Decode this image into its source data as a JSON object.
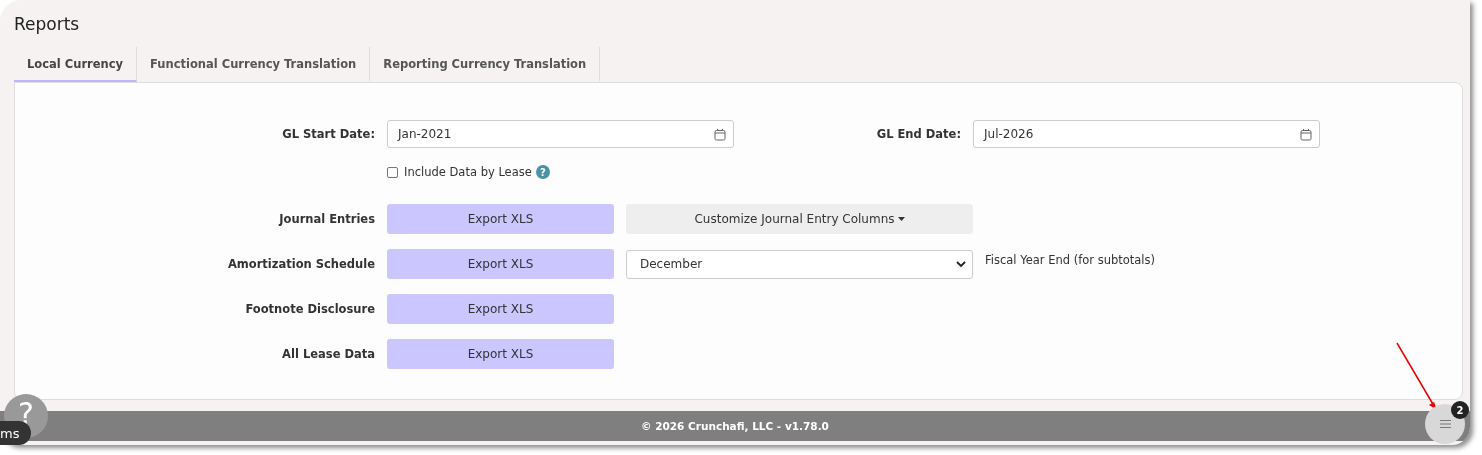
{
  "title": "Reports",
  "tabs": [
    {
      "label": "Local Currency",
      "selected": true
    },
    {
      "label": "Functional Currency Translation",
      "selected": false
    },
    {
      "label": "Reporting Currency Translation",
      "selected": false
    }
  ],
  "start_date": {
    "label": "GL Start Date:",
    "value": "Jan-2021"
  },
  "end_date": {
    "label": "GL End Date:",
    "value": "Jul-2026"
  },
  "include_by_lease": {
    "label": "Include Data by Lease",
    "checked": false,
    "help": "?"
  },
  "reports": [
    {
      "label": "Journal Entries",
      "button": "Export XLS",
      "extra": {
        "kind": "menu",
        "label": "Customize Journal Entry Columns"
      }
    },
    {
      "label": "Amortization Schedule",
      "button": "Export XLS",
      "extra": {
        "kind": "select",
        "value": "December",
        "note": "Fiscal Year End (for subtotals)"
      }
    },
    {
      "label": "Footnote Disclosure",
      "button": "Export XLS"
    },
    {
      "label": "All Lease Data",
      "button": "Export XLS"
    }
  ],
  "footer": "©  2026 Crunchafi, LLC - v1.78.0",
  "help_button": "?",
  "help_tab": "ms",
  "menu_badge": "2"
}
